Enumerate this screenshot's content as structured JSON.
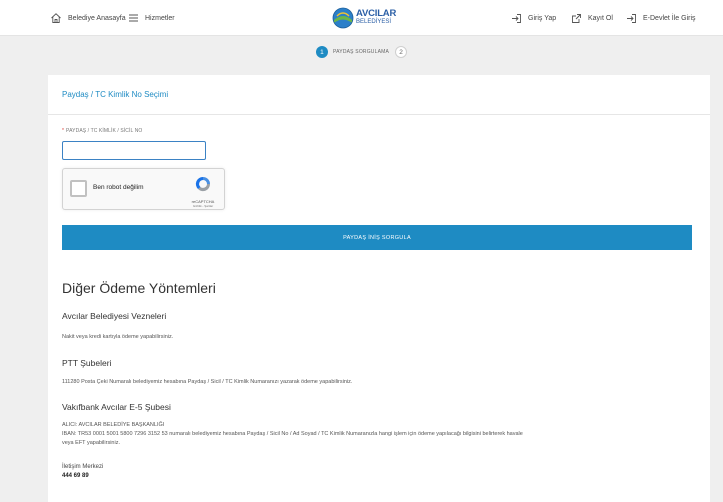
{
  "nav": {
    "home_label": "Belediye Anasayfa",
    "services_label": "Hizmetler",
    "login_label": "Giriş Yap",
    "register_label": "Kayıt Ol",
    "edevlet_label": "E-Devlet İle Giriş"
  },
  "logo": {
    "main": "AVCILAR",
    "sub": "BELEDİYESİ"
  },
  "stepper": {
    "step1_number": "1",
    "step1_label": "PAYDAŞ SORGULAMA",
    "step2_number": "2"
  },
  "form": {
    "title": "Paydaş / TC Kimlik No Seçimi",
    "required_mark": "*",
    "field_label": "PAYDAŞ / TC KİMLİK / SİCİL NO",
    "field_value": "",
    "recaptcha_label": "Ben robot değilim",
    "recaptcha_brand": "reCAPTCHA",
    "recaptcha_terms": "Gizlilik - Şartlar",
    "submit_label": "PAYDAŞ İNİŞ SORGULA"
  },
  "other_methods": {
    "heading": "Diğer Ödeme Yöntemleri",
    "sections": [
      {
        "title": "Avcılar Belediyesi Vezneleri",
        "text": "Nakit veya kredi kartıyla ödeme yapabilirsiniz."
      },
      {
        "title": "PTT Şubeleri",
        "text": "111280 Posta Çeki Numaralı belediyemiz hesabına Paydaş / Sicil / TC Kimlik Numaranızı yazarak ödeme yapabilirsiniz."
      },
      {
        "title": "Vakıfbank Avcılar E-5 Şubesi",
        "text_line1": "ALICI: AVCILAR BELEDİYE BAŞKANLIĞI",
        "text_line2": "IBAN: TR53 0001 5001 5800 7296 3152 53 numaralı belediyemiz hesabına Paydaş / Sicil No / Ad Soyad / TC Kimlik Numaranızla hangi işlem için ödeme yapılacağı bilgisini belirterek havale",
        "text_line3": "veya EFT yapabilirsiniz."
      }
    ],
    "contact_title": "İletişim Merkezi",
    "contact_value": "444 69 89"
  }
}
